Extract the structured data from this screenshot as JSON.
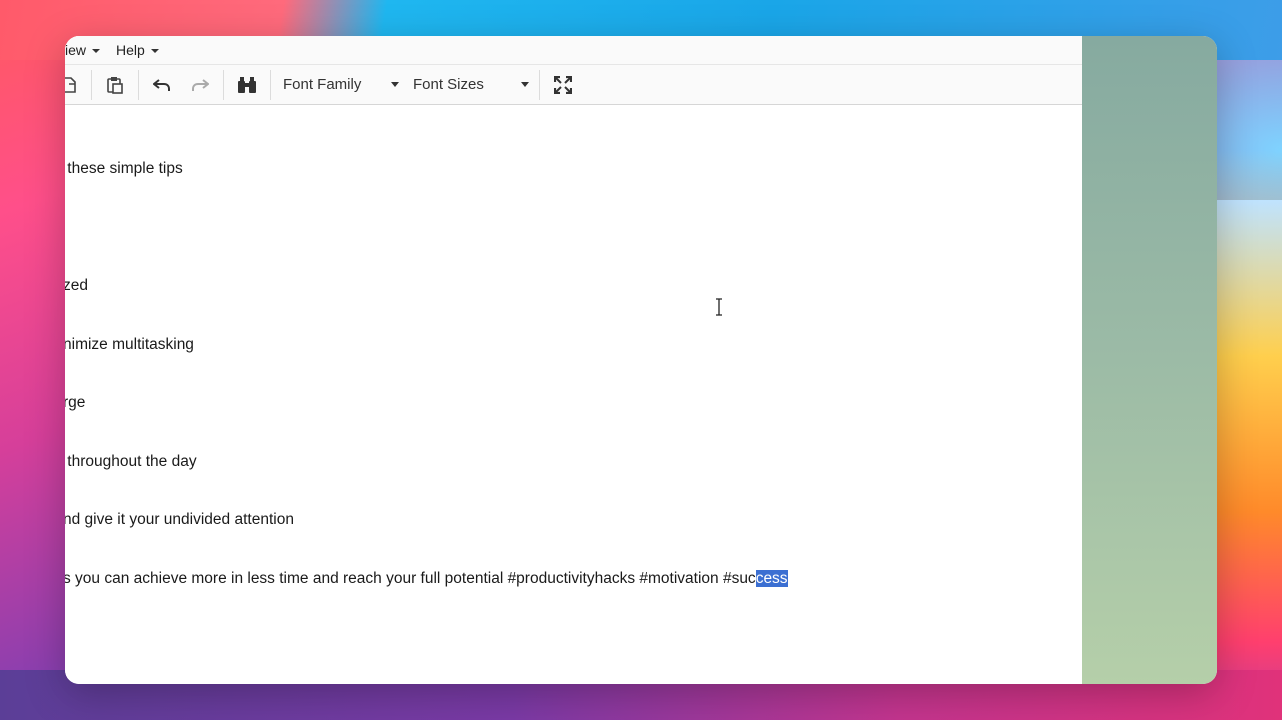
{
  "menubar": {
    "items": [
      {
        "label": "iew"
      },
      {
        "label": "Help"
      }
    ]
  },
  "toolbar": {
    "buttons": [
      "copy-icon",
      "paste-icon",
      "undo-icon",
      "redo-icon",
      "find-icon",
      "fullscreen-icon"
    ],
    "font_family_label": "Font Family",
    "font_sizes_label": "Font Sizes"
  },
  "document": {
    "lines": [
      " these simple tips",
      "",
      "zed",
      "nimize multitasking",
      "rge",
      " throughout the day",
      "nd give it your undivided attention"
    ],
    "last_line_plain": "s you can achieve more in less time and reach your full potential #productivityhacks #motivation #suc",
    "last_line_selected": "cess"
  },
  "colors": {
    "selection": "#3b6fd2",
    "side_panel": "#9cbba6"
  }
}
